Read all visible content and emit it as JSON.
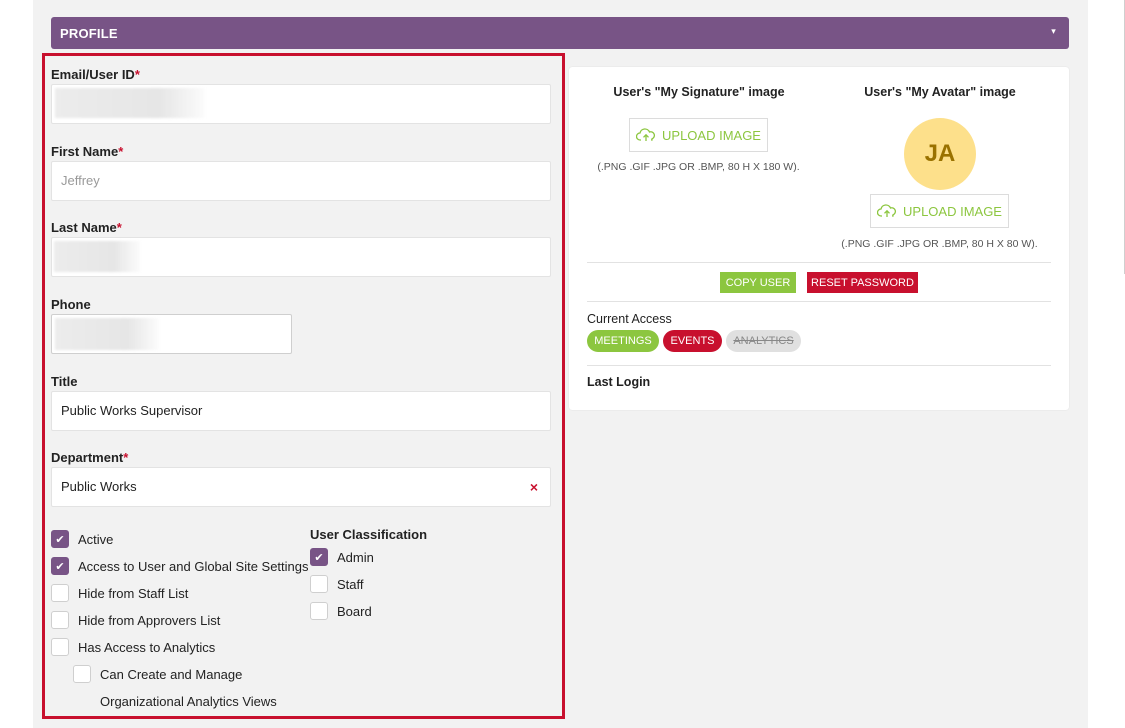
{
  "header": {
    "title": "PROFILE",
    "caret": "▾"
  },
  "form": {
    "email": {
      "label": "Email/User ID",
      "required": "*",
      "value": ""
    },
    "first_name": {
      "label": "First Name",
      "required": "*",
      "value": "Jeffrey"
    },
    "last_name": {
      "label": "Last Name",
      "required": "*",
      "value": ""
    },
    "phone": {
      "label": "Phone",
      "value": ""
    },
    "title": {
      "label": "Title",
      "value": "Public Works Supervisor"
    },
    "department": {
      "label": "Department",
      "required": "*",
      "value": "Public Works",
      "clear": "×"
    }
  },
  "checkboxes": [
    {
      "label": "Active",
      "checked": true
    },
    {
      "label": "Access to User and Global Site Settings",
      "checked": true
    },
    {
      "label": "Hide from Staff List",
      "checked": false
    },
    {
      "label": "Hide from Approvers List",
      "checked": false
    },
    {
      "label": "Has Access to Analytics",
      "checked": false
    },
    {
      "label": "Can Create and Manage",
      "checked": false
    },
    {
      "label": "Organizational Analytics Views"
    }
  ],
  "classification": {
    "label": "User Classification",
    "options": [
      {
        "label": "Admin",
        "checked": true
      },
      {
        "label": "Staff",
        "checked": false
      },
      {
        "label": "Board",
        "checked": false
      }
    ]
  },
  "images": {
    "signature_title": "User's \"My Signature\" image",
    "avatar_title": "User's \"My Avatar\" image",
    "upload_label": "UPLOAD IMAGE",
    "signature_hint": "(.PNG .GIF .JPG OR .BMP, 80 H X 180 W).",
    "avatar_hint": "(.PNG .GIF .JPG OR .BMP, 80 H X 80 W).",
    "avatar_initials": "JA"
  },
  "actions": {
    "copy_user": "COPY USER",
    "reset_password": "RESET PASSWORD"
  },
  "access": {
    "label": "Current Access",
    "pills": [
      {
        "label": "MEETINGS",
        "state": "active",
        "color": "#8cc63f"
      },
      {
        "label": "EVENTS",
        "state": "active",
        "color": "#c8102e"
      },
      {
        "label": "ANALYTICS",
        "state": "disabled",
        "color": "#e0e0e0"
      }
    ]
  },
  "last_login": {
    "label": "Last Login",
    "value": ""
  },
  "colors": {
    "brand_purple": "#785486",
    "accent_green": "#8cc63f",
    "accent_red": "#c8102e"
  }
}
